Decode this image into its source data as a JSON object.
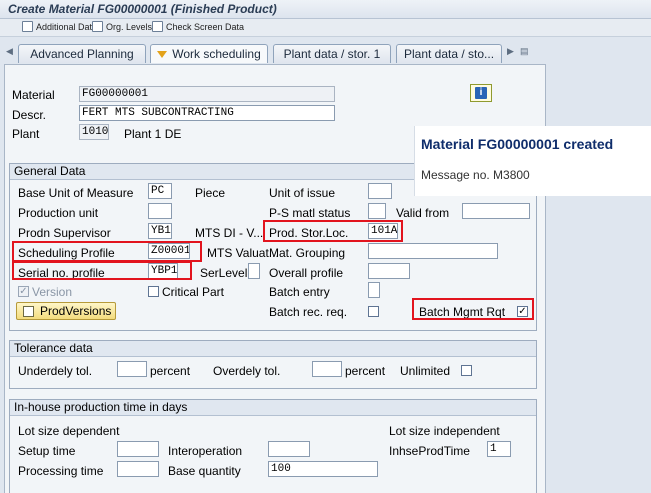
{
  "window": {
    "title": "Create Material FG00000001 (Finished Product)"
  },
  "toolbar": {
    "additional_data": "Additional Data",
    "org_levels": "Org. Levels",
    "check_screen_data": "Check Screen Data"
  },
  "tabs": [
    {
      "label": "Advanced Planning"
    },
    {
      "label": "Work scheduling"
    },
    {
      "label": "Plant data / stor. 1"
    },
    {
      "label": "Plant data / sto..."
    }
  ],
  "header": {
    "material_label": "Material",
    "material_value": "FG00000001",
    "descr_label": "Descr.",
    "descr_value": "FERT MTS SUBCONTRACTING",
    "plant_label": "Plant",
    "plant_value": "1010",
    "plant_name": "Plant 1 DE"
  },
  "popup": {
    "message": "Material FG00000001 created",
    "message_no": "Message no. M3800"
  },
  "general": {
    "title": "General Data",
    "base_uom_label": "Base Unit of Measure",
    "base_uom_value": "PC",
    "base_uom_text": "Piece",
    "unit_issue_label": "Unit of issue",
    "unit_issue_value": "",
    "prod_unit_label": "Production unit",
    "prod_unit_value": "",
    "ps_matl_label": "P-S matl status",
    "ps_matl_value": "",
    "valid_from_label": "Valid from",
    "valid_from_value": "",
    "prodn_sup_label": "Prodn Supervisor",
    "prodn_sup_value": "YB1",
    "prodn_sup_text": "MTS DI - V...",
    "prod_stor_label": "Prod. Stor.Loc.",
    "prod_stor_value": "101A",
    "sched_label": "Scheduling Profile",
    "sched_value": "Z00001",
    "mts_valuat": "MTS Valuat...",
    "mat_grouping_label": "Mat. Grouping",
    "mat_grouping_value": "",
    "serial_label": "Serial no. profile",
    "serial_value": "YBP1",
    "serlevel_label": "SerLevel",
    "serlevel_value": "",
    "overall_label": "Overall profile",
    "overall_value": "",
    "version_label": "Version",
    "version_checked": "✓",
    "critical_label": "Critical Part",
    "batch_entry_label": "Batch entry",
    "batch_entry_value": "",
    "prodversions_label": "ProdVersions",
    "batch_rec_label": "Batch rec. req.",
    "batch_mgmt_label": "Batch Mgmt Rqt",
    "batch_mgmt_checked": "✓"
  },
  "tolerance": {
    "title": "Tolerance data",
    "under_label": "Underdely tol.",
    "under_value": "",
    "under_unit": "percent",
    "over_label": "Overdely tol.",
    "over_value": "",
    "over_unit": "percent",
    "unlimited_label": "Unlimited"
  },
  "inhouse": {
    "title": "In-house production time in days",
    "dependent_label": "Lot size dependent",
    "independent_label": "Lot size independent",
    "setup_label": "Setup time",
    "setup_value": "",
    "interop_label": "Interoperation",
    "interop_value": "",
    "inhse_label": "InhseProdTime",
    "inhse_value": "1",
    "processing_label": "Processing time",
    "processing_value": "",
    "base_qty_label": "Base quantity",
    "base_qty_value": "100"
  },
  "colors": {
    "highlight": "#e2141e",
    "accent_tab_marker": "#e3a21a",
    "popup_title": "#0f2d6b"
  }
}
